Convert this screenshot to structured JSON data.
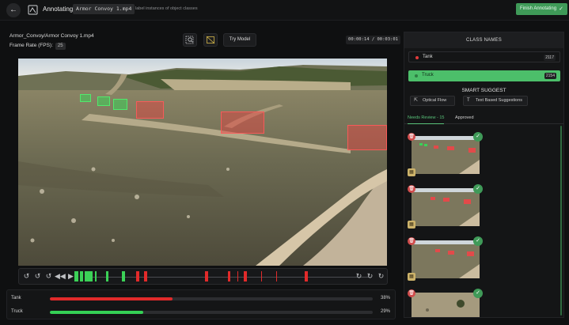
{
  "header": {
    "back_icon": "arrow-left-icon",
    "title": "Annotating",
    "file_name": "Armor Convoy 1.mp4",
    "subtitle": "label instances of object classes",
    "finish_label": "Finish Annotating"
  },
  "video": {
    "path": "Armor_Convoy/Armor Convoy 1.mp4",
    "fps_label": "Frame Rate (FPS):",
    "fps_value": "25",
    "timecode": "00:00:14 / 00:03:01",
    "try_model_label": "Try Model"
  },
  "timeline": {
    "left_controls": [
      "rewind-icon",
      "rewind-icon",
      "rewind-icon",
      "fast-backward-icon",
      "play-icon"
    ],
    "right_controls": [
      "forward-icon",
      "forward-icon",
      "forward-icon"
    ]
  },
  "stats": [
    {
      "label": "Tank",
      "percent_text": "38%",
      "fraction": 0.38,
      "color": "#e02a2a"
    },
    {
      "label": "Truck",
      "percent_text": "29%",
      "fraction": 0.29,
      "color": "#35d055"
    }
  ],
  "panel": {
    "class_names_title": "CLASS NAMES",
    "classes": [
      {
        "name": "Tank",
        "count": "2117",
        "color": "#e23b3b",
        "selected": false
      },
      {
        "name": "Truck",
        "count": "2154",
        "color": "#4cbf6a",
        "selected": true
      }
    ],
    "smart_suggest_title": "SMART SUGGEST",
    "optical_flow_label": "Optical Flow",
    "text_suggestions_label": "Text Based Suggestions",
    "tabs": {
      "needs_review": "Needs Review - 15",
      "approved": "Approved"
    }
  },
  "colors": {
    "accent_green": "#3f9a58",
    "tank_red": "#e23b3b",
    "truck_green": "#4cbf6a"
  }
}
